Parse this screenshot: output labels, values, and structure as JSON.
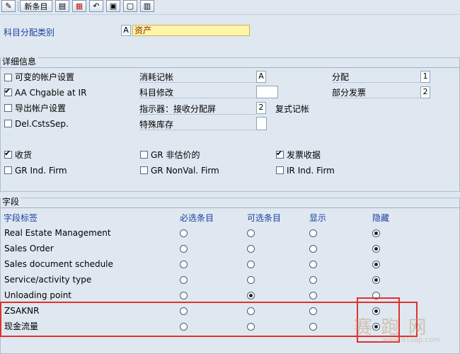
{
  "toolbar": {
    "new_entries_label": "新条目",
    "icons": [
      "copy-icon",
      "delete-icon",
      "undo-icon",
      "select-all-icon",
      "deselect-icon",
      "block-icon"
    ]
  },
  "header": {
    "label": "科目分配类别",
    "key": "A",
    "value": "资产"
  },
  "details": {
    "title": "详细信息",
    "checkboxes": {
      "changeable_account": {
        "label": "可变的帐户设置",
        "checked": false
      },
      "aa_chgable": {
        "label": "AA Chgable at IR",
        "checked": true
      },
      "derive_account": {
        "label": "导出帐户设置",
        "checked": false
      },
      "del_csts": {
        "label": "Del.CstsSep.",
        "checked": false
      }
    },
    "fields": {
      "consumption": {
        "label": "消耗记帐",
        "value": "A"
      },
      "account_mod": {
        "label": "科目修改",
        "value": ""
      },
      "indicator": {
        "label": "指示器：接收分配屏",
        "value": "2"
      },
      "special_stock": {
        "label": "特殊库存",
        "value": ""
      },
      "distribution": {
        "label": "分配",
        "value": "1"
      },
      "partial_invoice": {
        "label": "部分发票",
        "value": "2"
      }
    },
    "repeat_posting_label": "复式记帐",
    "receipt_checks": {
      "goods_receipt": {
        "label": "收货",
        "checked": true
      },
      "gr_ind_firm": {
        "label": "GR Ind. Firm",
        "checked": false
      },
      "gr_nonvaluated": {
        "label": "GR 非估价的",
        "checked": false
      },
      "gr_nonval_firm": {
        "label": "GR NonVal. Firm",
        "checked": false
      },
      "invoice_receipt": {
        "label": "发票收据",
        "checked": true
      },
      "ir_ind_firm": {
        "label": "IR Ind. Firm",
        "checked": false
      }
    }
  },
  "fields_section": {
    "title": "字段",
    "columns": {
      "label": "字段标签",
      "required": "必选条目",
      "optional": "可选条目",
      "display": "显示",
      "hidden": "隐藏"
    },
    "rows": [
      {
        "label": "Real Estate Management",
        "selected": "hidden"
      },
      {
        "label": "Sales Order",
        "selected": "hidden"
      },
      {
        "label": "Sales document schedule",
        "selected": "hidden"
      },
      {
        "label": "Service/activity type",
        "selected": "hidden"
      },
      {
        "label": "Unloading point",
        "selected": "optional"
      },
      {
        "label": "ZSAKNR",
        "selected": "hidden"
      },
      {
        "label": "现金流量",
        "selected": "hidden"
      }
    ]
  },
  "colors": {
    "highlight": "#e0312d",
    "label_blue": "#1b3fa0",
    "background": "#dfe8f1",
    "field_yellow": "#fff5a8"
  },
  "watermark": {
    "text": "赛 跑 网",
    "url": "www.91sap.com"
  }
}
